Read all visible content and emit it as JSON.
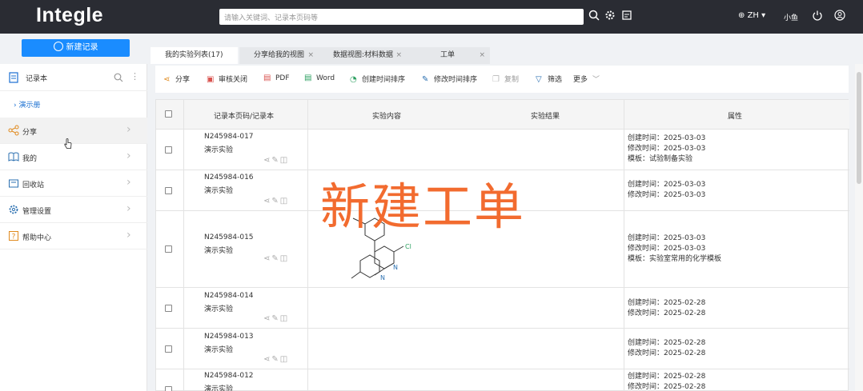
{
  "topbar": {
    "logo": "Integle",
    "search_placeholder": "请输入关键词、记录本页码等",
    "lang": "ZH",
    "user": "小鱼"
  },
  "sidebar": {
    "new_record": "新建记录",
    "notebook_title": "记录本",
    "notebook_sub": "演示册",
    "items": [
      {
        "label": "分享",
        "icon": "share-icon"
      },
      {
        "label": "我的",
        "icon": "book-icon"
      },
      {
        "label": "回收站",
        "icon": "recycle-icon"
      },
      {
        "label": "管理设置",
        "icon": "gear-icon"
      },
      {
        "label": "帮助中心",
        "icon": "help-icon"
      }
    ]
  },
  "tabs": [
    {
      "label": "我的实验列表(17)"
    },
    {
      "label": "分享给我的视图",
      "close": "×"
    },
    {
      "label": "数据视图:材料数据",
      "close": "×"
    },
    {
      "label": "工单",
      "close": "×"
    }
  ],
  "toolbar": [
    {
      "label": "分享",
      "icon": "share-icon"
    },
    {
      "label": "审核关闭",
      "icon": "review-icon"
    },
    {
      "label": "PDF",
      "icon": "pdf-icon"
    },
    {
      "label": "Word",
      "icon": "word-icon"
    },
    {
      "label": "创建时间排序",
      "icon": "clock-icon"
    },
    {
      "label": "修改时间排序",
      "icon": "edit-icon"
    },
    {
      "label": "复制",
      "icon": "copy-icon"
    },
    {
      "label": "筛选",
      "icon": "filter-icon"
    },
    {
      "label": "更多",
      "icon": "chevron-down-icon"
    }
  ],
  "table": {
    "headers": {
      "code": "记录本页码/记录本",
      "content": "实验内容",
      "result": "实验结果",
      "props": "属性"
    },
    "rows": [
      {
        "code": "N245984-017",
        "notebook": "演示实验",
        "created": "创建时间：2025-03-03",
        "modified": "修改时间：2025-03-03",
        "template": "模板：试验制备实验"
      },
      {
        "code": "N245984-016",
        "notebook": "演示实验",
        "created": "创建时间：2025-03-03",
        "modified": "修改时间：2025-03-03",
        "template": ""
      },
      {
        "code": "N245984-015",
        "notebook": "演示实验",
        "created": "创建时间：2025-03-03",
        "modified": "修改时间：2025-03-03",
        "template": "模板：实验室常用的化学模板"
      },
      {
        "code": "N245984-014",
        "notebook": "演示实验",
        "created": "创建时间：2025-02-28",
        "modified": "修改时间：2025-02-28",
        "template": ""
      },
      {
        "code": "N245984-013",
        "notebook": "演示实验",
        "created": "创建时间：2025-02-28",
        "modified": "修改时间：2025-02-28",
        "template": ""
      },
      {
        "code": "N245984-012",
        "notebook": "演示实验",
        "created": "创建时间：2025-02-28",
        "modified": "修改时间：2025-02-28",
        "template": ""
      }
    ]
  },
  "molecule": {
    "atom_cl": "Cl",
    "atom_n1": "N",
    "atom_n2": "N"
  },
  "overlay": "新建工单"
}
